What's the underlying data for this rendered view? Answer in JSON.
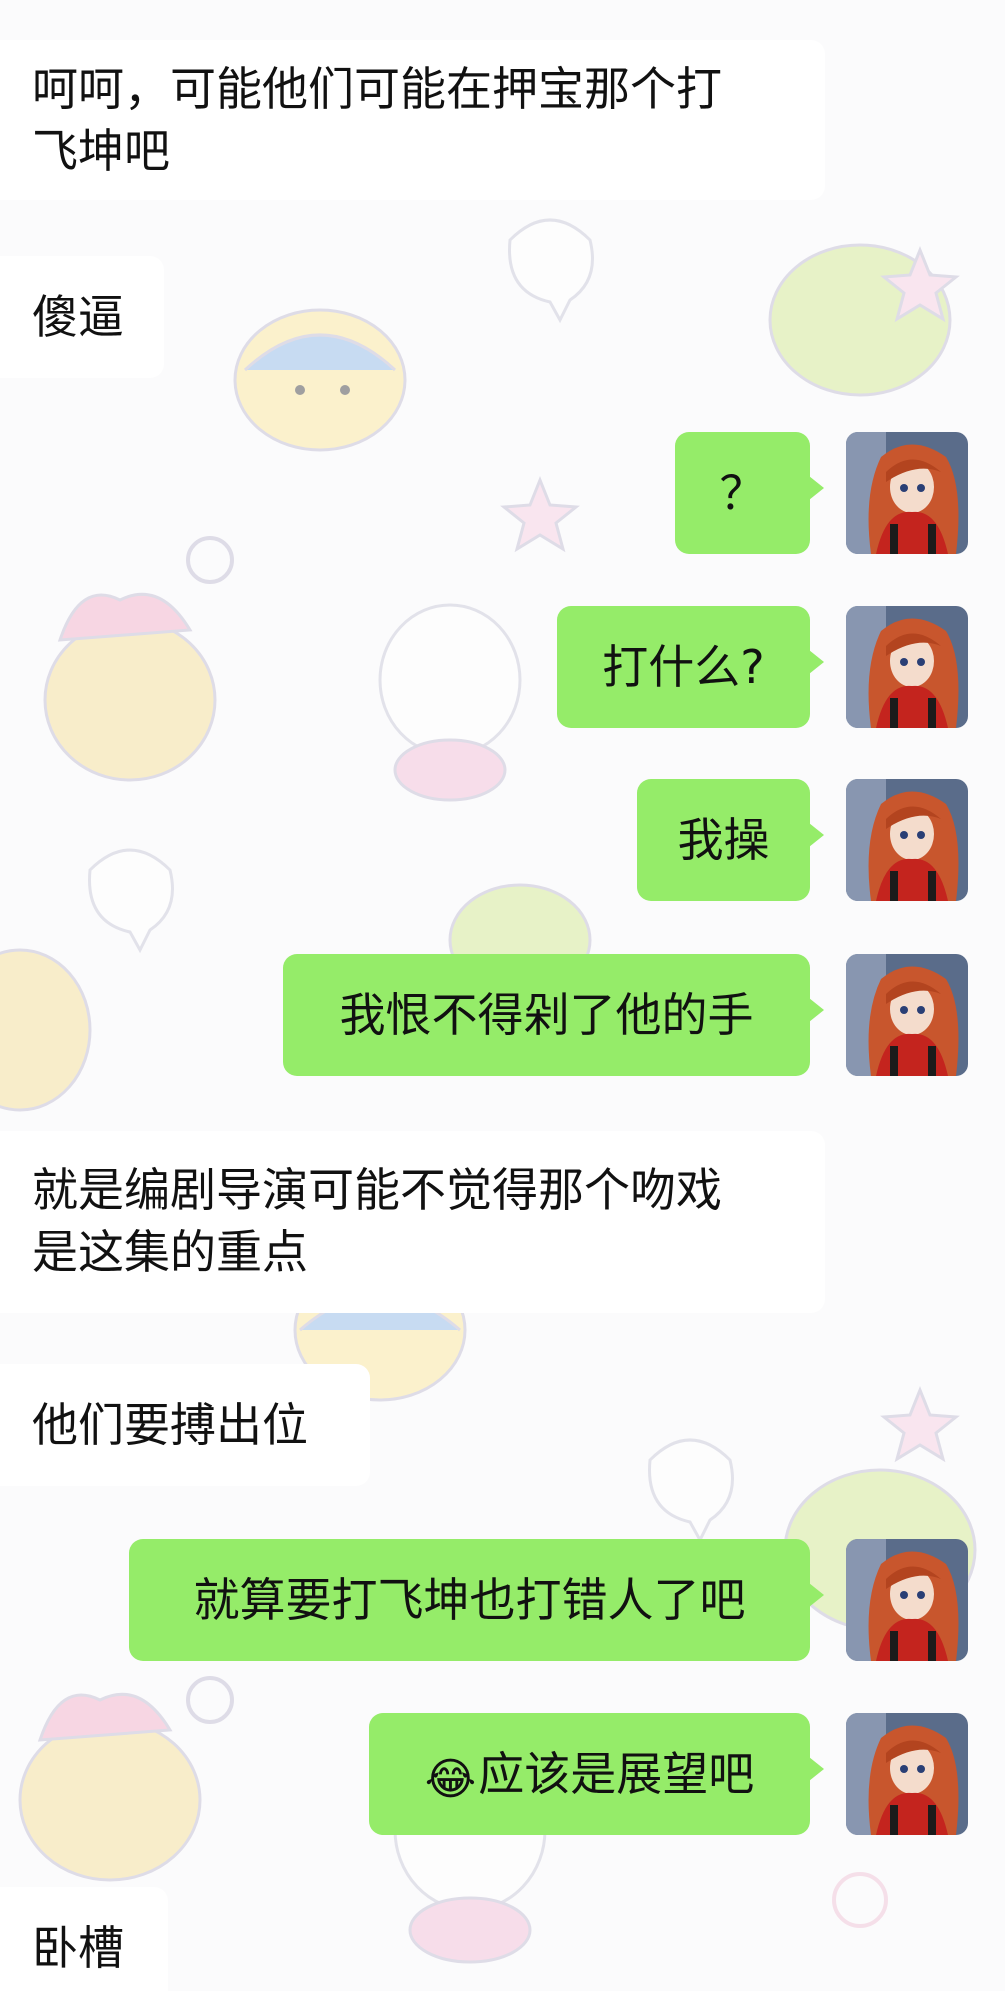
{
  "messages": [
    {
      "side": "left",
      "lines": [
        "呵呵，可能他们可能在押宝那个打",
        "飞坤吧"
      ]
    },
    {
      "side": "left",
      "lines": [
        "傻逼"
      ]
    },
    {
      "side": "right",
      "text": "？"
    },
    {
      "side": "right",
      "text": "打什么?"
    },
    {
      "side": "right",
      "text": "我操"
    },
    {
      "side": "right",
      "text": "我恨不得剁了他的手"
    },
    {
      "side": "left",
      "lines": [
        "就是编剧导演可能不觉得那个吻戏",
        "是这集的重点"
      ]
    },
    {
      "side": "left",
      "lines": [
        "他们要搏出位"
      ]
    },
    {
      "side": "right",
      "text": "就算要打飞坤也打错人了吧"
    },
    {
      "side": "right",
      "emoji": "😂",
      "emoji_name": "tears-of-joy-icon",
      "text": "应该是展望吧"
    },
    {
      "side": "left",
      "lines": [
        "卧槽"
      ]
    }
  ],
  "colors": {
    "self_bubble": "#95ec69",
    "other_bubble": "#ffffff",
    "background": "#fbfbfc"
  },
  "avatar": {
    "icon": "anime-girl-avatar-icon"
  }
}
